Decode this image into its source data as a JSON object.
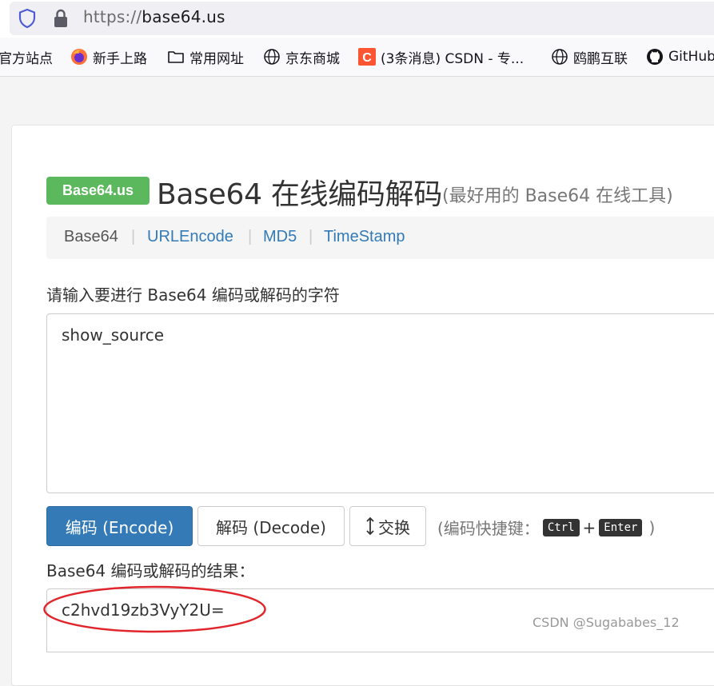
{
  "browser": {
    "url_scheme": "https://",
    "url_host": "base64.us",
    "bookmarks": [
      {
        "label": "官方站点",
        "icon": "none"
      },
      {
        "label": "新手上路",
        "icon": "firefox-icon"
      },
      {
        "label": "常用网址",
        "icon": "folder-icon"
      },
      {
        "label": "京东商城",
        "icon": "globe-icon"
      },
      {
        "label": "(3条消息) CSDN - 专...",
        "icon": "csdn-icon"
      },
      {
        "label": "鸥鹏互联",
        "icon": "globe-icon"
      },
      {
        "label": "GitHub",
        "icon": "github-icon"
      }
    ]
  },
  "header": {
    "badge": "Base64.us",
    "title": "Base64 在线编码解码",
    "subtitle": "(最好用的 Base64 在线工具)"
  },
  "nav": {
    "items": [
      {
        "label": "Base64",
        "active": true
      },
      {
        "label": "URLEncode",
        "active": false
      },
      {
        "label": "MD5",
        "active": false
      },
      {
        "label": "TimeStamp",
        "active": false
      }
    ],
    "separator": "|"
  },
  "form": {
    "input_label": "请输入要进行 Base64 编码或解码的字符",
    "input_value": "show_source",
    "encode_label": "编码 (Encode)",
    "decode_label": "解码 (Decode)",
    "swap_label": "交换",
    "hint_prefix": "(编码快捷键：",
    "hint_key1": "Ctrl",
    "hint_plus": "+",
    "hint_key2": "Enter",
    "hint_suffix": ")",
    "result_label": "Base64 编码或解码的结果：",
    "result_value": "c2hvd19zb3VyY2U="
  },
  "watermark": "CSDN @Sugababes_12",
  "colors": {
    "badge": "#5cb85c",
    "primary": "#337ab7",
    "link": "#337ab7",
    "annotation": "#e0262c"
  }
}
